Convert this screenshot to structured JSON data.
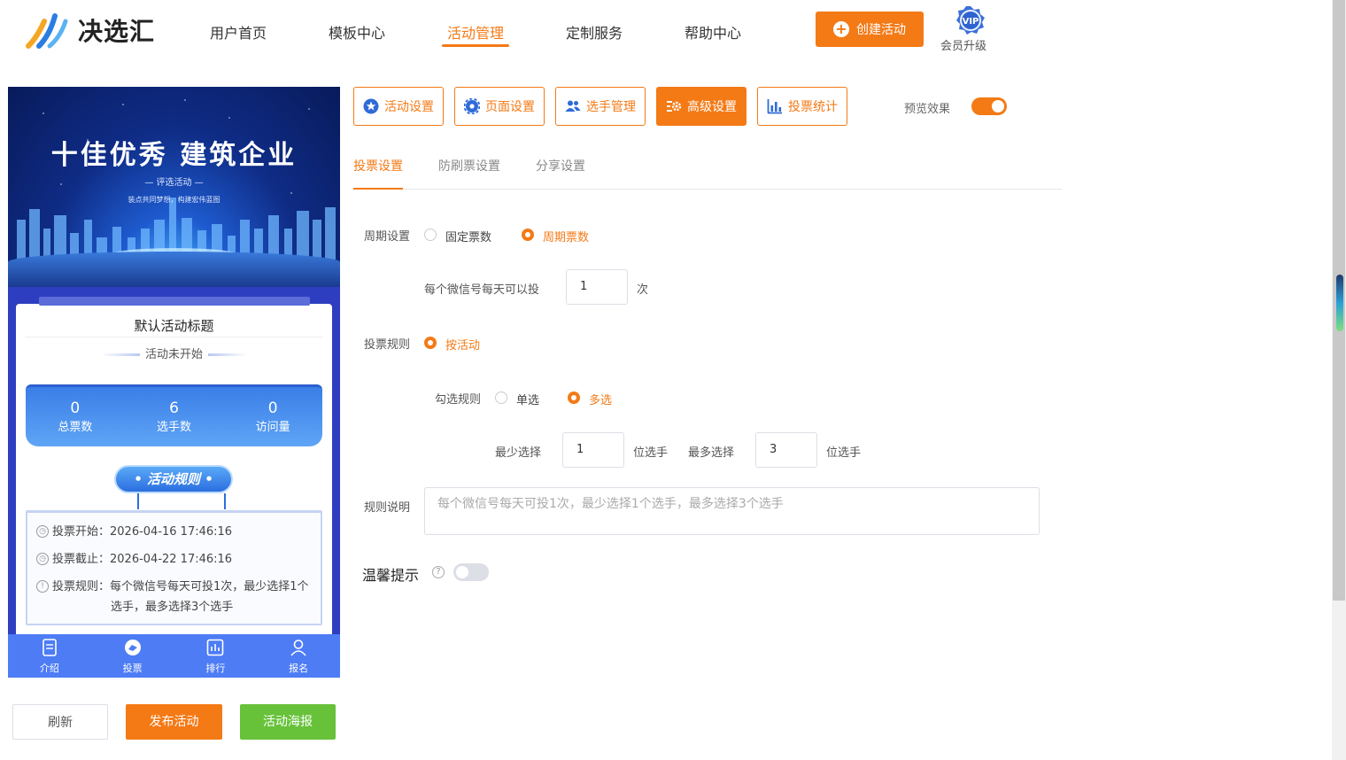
{
  "header": {
    "logo_text": "决选汇",
    "nav": [
      "用户首页",
      "模板中心",
      "活动管理",
      "定制服务",
      "帮助中心"
    ],
    "active_nav": "活动管理",
    "create_button": "创建活动",
    "vip_badge": "VIP",
    "vip_label": "会员升级"
  },
  "preview": {
    "banner_title": "十佳优秀  建筑企业",
    "banner_sub": "— 评选活动 —",
    "banner_sub2": "装点共同梦想，构建宏伟蓝图",
    "card_title": "默认活动标题",
    "card_status": "活动未开始",
    "stats": [
      {
        "value": "0",
        "label": "总票数"
      },
      {
        "value": "6",
        "label": "选手数"
      },
      {
        "value": "0",
        "label": "访问量"
      }
    ],
    "rules_button": "• 活动规则 •",
    "rules": {
      "start": "投票开始：2026-04-16 17:46:16",
      "end": "投票截止：2026-04-22 17:46:16",
      "rule_line1": "投票规则：每个微信号每天可投1次，最少选择1个",
      "rule_line2": "选手，最多选择3个选手"
    },
    "tabbar": [
      "介绍",
      "投票",
      "排行",
      "报名"
    ]
  },
  "bottom_buttons": {
    "refresh": "刷新",
    "publish": "发布活动",
    "poster": "活动海报"
  },
  "toolbar": {
    "buttons": [
      "活动设置",
      "页面设置",
      "选手管理",
      "高级设置",
      "投票统计"
    ],
    "active": "高级设置",
    "preview_label": "预览效果",
    "preview_on": true
  },
  "subtabs": {
    "items": [
      "投票设置",
      "防刷票设置",
      "分享设置"
    ],
    "active": "投票设置"
  },
  "form": {
    "cycle_label": "周期设置",
    "cycle_options": [
      "固定票数",
      "周期票数"
    ],
    "cycle_selected": "周期票数",
    "per_day_label": "每个微信号每天可以投",
    "per_day_value": "1",
    "per_day_unit": "次",
    "vote_rule_label": "投票规则",
    "vote_rule_option": "按活动",
    "check_rule_label": "勾选规则",
    "check_options": [
      "单选",
      "多选"
    ],
    "check_selected": "多选",
    "min_label": "最少选择",
    "min_value": "1",
    "min_unit": "位选手",
    "max_label": "最多选择",
    "max_value": "3",
    "max_unit": "位选手",
    "desc_label": "规则说明",
    "desc_placeholder": "每个微信号每天可投1次，最少选择1个选手，最多选择3个选手",
    "tip_label": "温馨提示",
    "tip_help": "?",
    "tip_on": false
  },
  "colors": {
    "accent": "#f47a16",
    "poster_green": "#67c23a",
    "phone_blue": "#2e3ec0"
  }
}
